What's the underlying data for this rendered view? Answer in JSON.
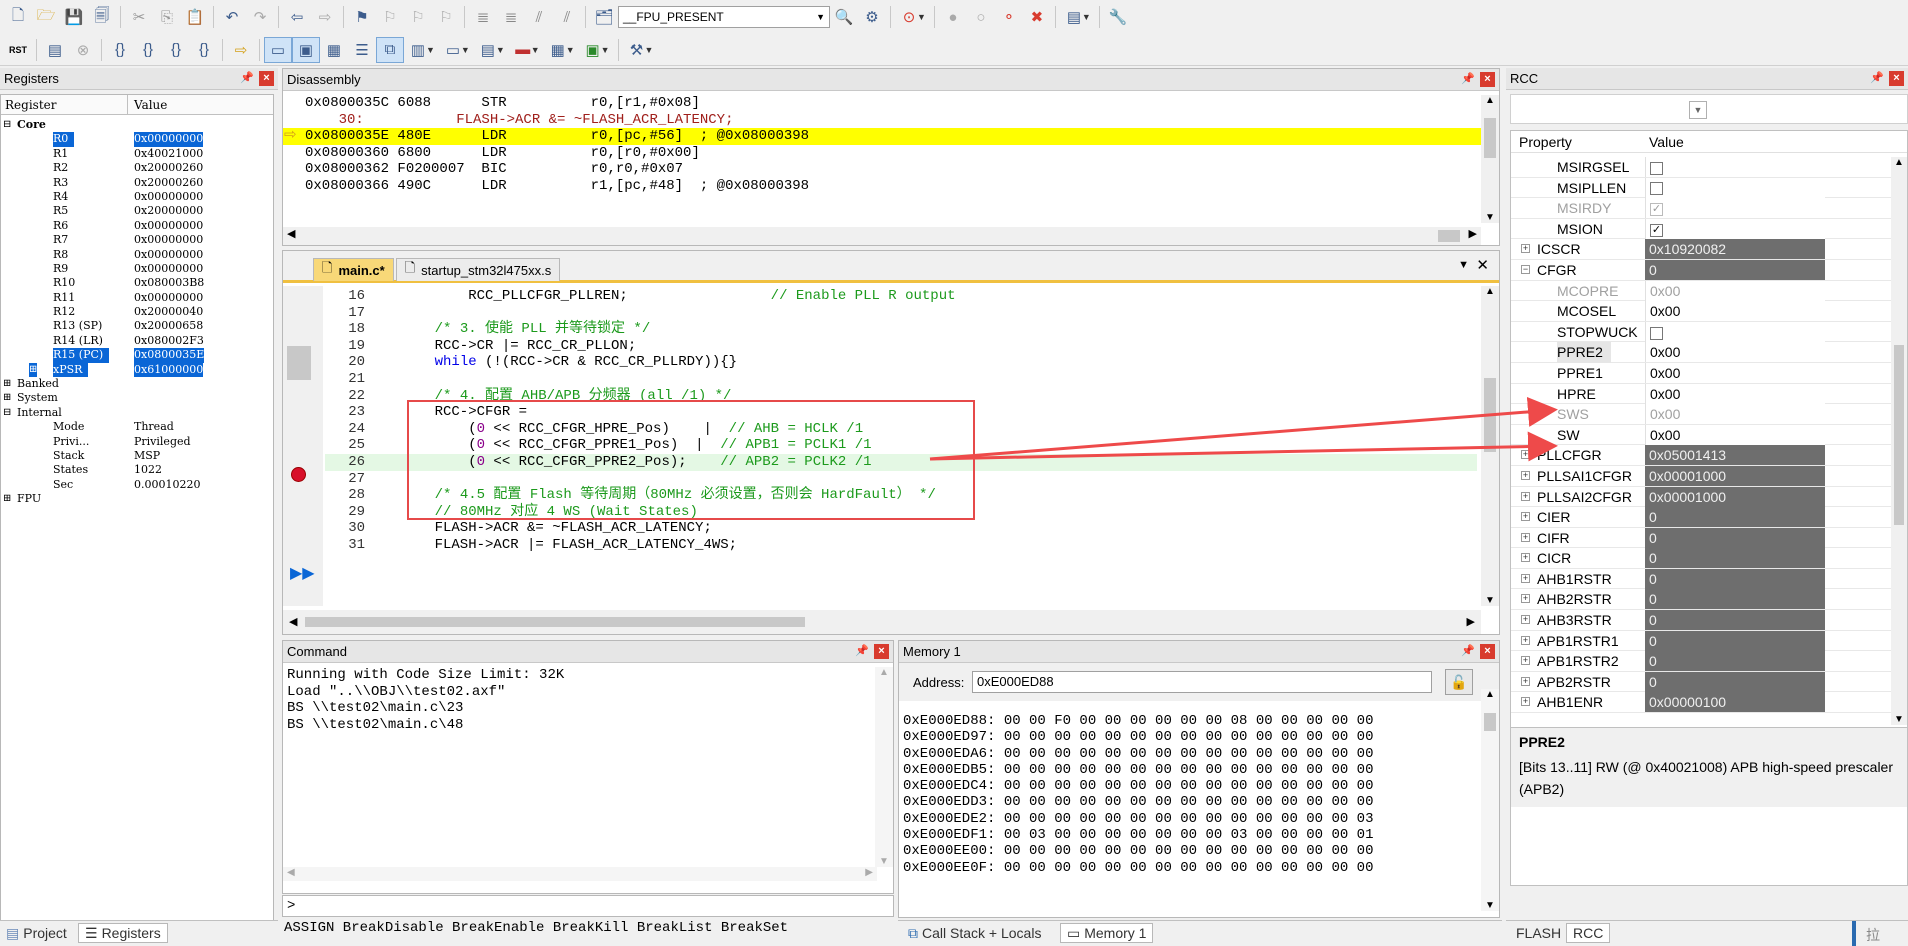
{
  "toolbar1": {
    "target_combo": "__FPU_PRESENT"
  },
  "toolbar2": {
    "rst_label": "RST"
  },
  "registers": {
    "title": "Registers",
    "col_register": "Register",
    "col_value": "Value",
    "groups": [
      {
        "name": "Core",
        "bold": true
      },
      {
        "name": "Banked"
      },
      {
        "name": "System"
      },
      {
        "name": "Internal"
      },
      {
        "name": "FPU"
      }
    ],
    "core": [
      {
        "name": "R0",
        "value": "0x00000000",
        "sel": true
      },
      {
        "name": "R1",
        "value": "0x40021000"
      },
      {
        "name": "R2",
        "value": "0x20000260"
      },
      {
        "name": "R3",
        "value": "0x20000260"
      },
      {
        "name": "R4",
        "value": "0x00000000"
      },
      {
        "name": "R5",
        "value": "0x20000000"
      },
      {
        "name": "R6",
        "value": "0x00000000"
      },
      {
        "name": "R7",
        "value": "0x00000000"
      },
      {
        "name": "R8",
        "value": "0x00000000"
      },
      {
        "name": "R9",
        "value": "0x00000000"
      },
      {
        "name": "R10",
        "value": "0x080003B8"
      },
      {
        "name": "R11",
        "value": "0x00000000"
      },
      {
        "name": "R12",
        "value": "0x20000040"
      },
      {
        "name": "R13 (SP)",
        "value": "0x20000658"
      },
      {
        "name": "R14 (LR)",
        "value": "0x080002F3"
      },
      {
        "name": "R15 (PC)",
        "value": "0x0800035E",
        "sel": true
      },
      {
        "name": "xPSR",
        "value": "0x61000000",
        "sel": true
      }
    ],
    "internal": [
      {
        "name": "Mode",
        "value": "Thread"
      },
      {
        "name": "Privi...",
        "value": "Privileged"
      },
      {
        "name": "Stack",
        "value": "MSP"
      },
      {
        "name": "States",
        "value": "1022"
      },
      {
        "name": "Sec",
        "value": "0.00010220"
      }
    ],
    "bottom_tabs": [
      "Project",
      "Registers"
    ]
  },
  "disassembly": {
    "title": "Disassembly",
    "lines": [
      {
        "text": "0x0800035C 6088      STR          r0,[r1,#0x08]",
        "hl": false
      },
      {
        "text": "    30:           FLASH->ACR &= ~FLASH_ACR_LATENCY;",
        "src": true
      },
      {
        "text": "0x0800035E 480E      LDR          r0,[pc,#56]  ; @0x08000398",
        "hl": true
      },
      {
        "text": "0x08000360 6800      LDR          r0,[r0,#0x00]",
        "hl": false
      },
      {
        "text": "0x08000362 F0200007  BIC          r0,r0,#0x07",
        "hl": false
      },
      {
        "text": "0x08000366 490C      LDR          r1,[pc,#48]  ; @0x08000398",
        "hl": false
      }
    ]
  },
  "editor": {
    "tabs": [
      {
        "label": "main.c*",
        "active": true
      },
      {
        "label": "startup_stm32l475xx.s",
        "active": false
      }
    ],
    "lines": [
      {
        "no": "16",
        "html": "        RCC_PLLCFGR_PLLREN;                 <span class='cm'>// Enable PLL R output</span>"
      },
      {
        "no": "17",
        "html": ""
      },
      {
        "no": "18",
        "html": "    <span class='cm'>/* 3. 使能 PLL 并等待锁定 */</span>"
      },
      {
        "no": "19",
        "html": "    RCC->CR |= RCC_CR_PLLON;"
      },
      {
        "no": "20",
        "html": "    <span class='kw'>while</span> (!(RCC->CR &amp; RCC_CR_PLLRDY)){}"
      },
      {
        "no": "21",
        "html": ""
      },
      {
        "no": "22",
        "html": "    <span class='cm'>/* 4. 配置 AHB/APB 分频器 (all /1) */</span>"
      },
      {
        "no": "23",
        "html": "    RCC->CFGR ="
      },
      {
        "no": "24",
        "html": "        (<span class='num'>0</span> &lt;&lt; RCC_CFGR_HPRE_Pos)    |  <span class='cm'>// AHB = HCLK /1</span>"
      },
      {
        "no": "25",
        "html": "        (<span class='num'>0</span> &lt;&lt; RCC_CFGR_PPRE1_Pos)  |  <span class='cm'>// APB1 = PCLK1 /1</span>"
      },
      {
        "no": "26",
        "html": "        (<span class='num'>0</span> &lt;&lt; RCC_CFGR_PPRE2_Pos);    <span class='cm'>// APB2 = PCLK2 /1</span>"
      },
      {
        "no": "27",
        "html": ""
      },
      {
        "no": "28",
        "html": "    <span class='cm'>/* 4.5 配置 Flash 等待周期（80MHz 必须设置，否则会 HardFault） */</span>"
      },
      {
        "no": "29",
        "html": "    <span class='cm'>// 80MHz 对应 4 WS (Wait States)</span>"
      },
      {
        "no": "30",
        "html": "    FLASH->ACR &amp;= ~FLASH_ACR_LATENCY;"
      },
      {
        "no": "31",
        "html": "    FLASH->ACR |= FLASH_ACR_LATENCY_4WS;"
      }
    ]
  },
  "command": {
    "title": "Command",
    "lines": [
      "Running with Code Size Limit: 32K",
      "Load \"..\\\\OBJ\\\\test02.axf\"",
      "BS \\\\test02\\main.c\\23",
      "BS \\\\test02\\main.c\\48"
    ],
    "prompt": ">",
    "hints": "ASSIGN BreakDisable BreakEnable BreakKill BreakList BreakSet"
  },
  "memory": {
    "title": "Memory 1",
    "address_label": "Address:",
    "address_value": "0xE000ED88",
    "rows": [
      "0xE000ED88: 00 00 F0 00 00 00 00 00 00 08 00 00 00 00 00",
      "0xE000ED97: 00 00 00 00 00 00 00 00 00 00 00 00 00 00 00",
      "0xE000EDA6: 00 00 00 00 00 00 00 00 00 00 00 00 00 00 00",
      "0xE000EDB5: 00 00 00 00 00 00 00 00 00 00 00 00 00 00 00",
      "0xE000EDC4: 00 00 00 00 00 00 00 00 00 00 00 00 00 00 00",
      "0xE000EDD3: 00 00 00 00 00 00 00 00 00 00 00 00 00 00 00",
      "0xE000EDE2: 00 00 00 00 00 00 00 00 00 00 00 00 00 00 03",
      "0xE000EDF1: 00 03 00 00 00 00 00 00 00 03 00 00 00 00 01",
      "0xE000EE00: 00 00 00 00 00 00 00 00 00 00 00 00 00 00 00",
      "0xE000EE0F: 00 00 00 00 00 00 00 00 00 00 00 00 00 00 00"
    ],
    "bottom_tabs": [
      "Call Stack + Locals",
      "Memory 1"
    ]
  },
  "rcc": {
    "title": "RCC",
    "col_property": "Property",
    "col_value": "Value",
    "rows": [
      {
        "name": "MSIRGSEL",
        "type": "chk",
        "checked": false,
        "indent": 2
      },
      {
        "name": "MSIPLLEN",
        "type": "chk",
        "checked": false,
        "indent": 2
      },
      {
        "name": "MSIRDY",
        "type": "chk",
        "checked": true,
        "indent": 2,
        "gray": true
      },
      {
        "name": "MSION",
        "type": "chk",
        "checked": true,
        "indent": 2
      },
      {
        "name": "ICSCR",
        "type": "dark",
        "value": "0x10920082",
        "indent": 1,
        "exp": "+"
      },
      {
        "name": "CFGR",
        "type": "dark",
        "value": "0",
        "indent": 1,
        "exp": "−"
      },
      {
        "name": "MCOPRE",
        "type": "light",
        "value": "0x00",
        "indent": 2,
        "gray": true
      },
      {
        "name": "MCOSEL",
        "type": "light",
        "value": "0x00",
        "indent": 2
      },
      {
        "name": "STOPWUCK",
        "type": "chk",
        "checked": false,
        "indent": 2
      },
      {
        "name": "PPRE2",
        "type": "light",
        "value": "0x00",
        "indent": 2,
        "sel": true
      },
      {
        "name": "PPRE1",
        "type": "light",
        "value": "0x00",
        "indent": 2
      },
      {
        "name": "HPRE",
        "type": "light",
        "value": "0x00",
        "indent": 2
      },
      {
        "name": "SWS",
        "type": "light",
        "value": "0x00",
        "indent": 2,
        "gray": true
      },
      {
        "name": "SW",
        "type": "light",
        "value": "0x00",
        "indent": 2
      },
      {
        "name": "PLLCFGR",
        "type": "dark",
        "value": "0x05001413",
        "indent": 1,
        "exp": "+"
      },
      {
        "name": "PLLSAI1CFGR",
        "type": "dark",
        "value": "0x00001000",
        "indent": 1,
        "exp": "+"
      },
      {
        "name": "PLLSAI2CFGR",
        "type": "dark",
        "value": "0x00001000",
        "indent": 1,
        "exp": "+"
      },
      {
        "name": "CIER",
        "type": "dark",
        "value": "0",
        "indent": 1,
        "exp": "+"
      },
      {
        "name": "CIFR",
        "type": "dark",
        "value": "0",
        "indent": 1,
        "exp": "+"
      },
      {
        "name": "CICR",
        "type": "dark",
        "value": "0",
        "indent": 1,
        "exp": "+"
      },
      {
        "name": "AHB1RSTR",
        "type": "dark",
        "value": "0",
        "indent": 1,
        "exp": "+"
      },
      {
        "name": "AHB2RSTR",
        "type": "dark",
        "value": "0",
        "indent": 1,
        "exp": "+"
      },
      {
        "name": "AHB3RSTR",
        "type": "dark",
        "value": "0",
        "indent": 1,
        "exp": "+"
      },
      {
        "name": "APB1RSTR1",
        "type": "dark",
        "value": "0",
        "indent": 1,
        "exp": "+"
      },
      {
        "name": "APB1RSTR2",
        "type": "dark",
        "value": "0",
        "indent": 1,
        "exp": "+"
      },
      {
        "name": "APB2RSTR",
        "type": "dark",
        "value": "0",
        "indent": 1,
        "exp": "+"
      },
      {
        "name": "AHB1ENR",
        "type": "dark",
        "value": "0x00000100",
        "indent": 1,
        "exp": "+"
      }
    ],
    "desc_title": "PPRE2",
    "desc_text": "[Bits 13..11] RW (@ 0x40021008) APB high-speed prescaler (APB2)",
    "bottom_tabs": [
      "FLASH",
      "RCC"
    ],
    "edge_glyph": "拉"
  },
  "colors": {
    "exec_highlight": "#ffff00",
    "selection": "#0a66d6",
    "annotation": "#ee4a4a"
  }
}
